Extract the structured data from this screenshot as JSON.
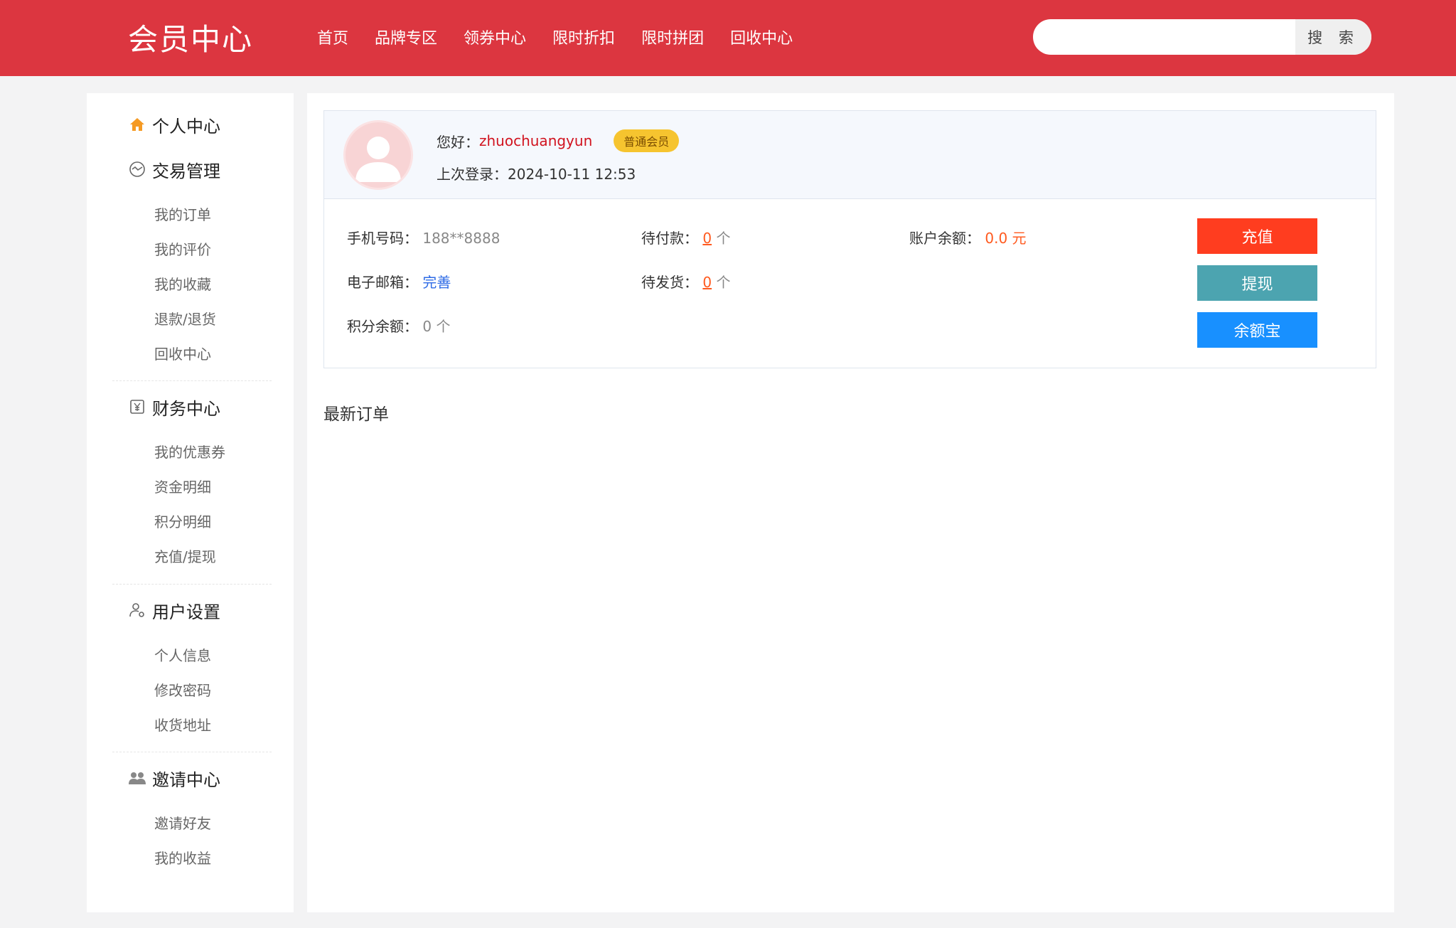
{
  "header": {
    "logo": "会员中心",
    "nav": [
      "首页",
      "品牌专区",
      "领券中心",
      "限时折扣",
      "限时拼团",
      "回收中心"
    ],
    "search": {
      "placeholder": "",
      "button_label": "搜 索"
    }
  },
  "sidebar": {
    "groups": [
      {
        "title": "个人中心",
        "icon": "home-icon",
        "items": []
      },
      {
        "title": "交易管理",
        "icon": "trade-icon",
        "items": [
          "我的订单",
          "我的评价",
          "我的收藏",
          "退款/退货",
          "回收中心"
        ]
      },
      {
        "title": "财务中心",
        "icon": "finance-icon",
        "items": [
          "我的优惠券",
          "资金明细",
          "积分明细",
          "充值/提现"
        ]
      },
      {
        "title": "用户设置",
        "icon": "user-settings-icon",
        "items": [
          "个人信息",
          "修改密码",
          "收货地址"
        ]
      },
      {
        "title": "邀请中心",
        "icon": "invite-icon",
        "items": [
          "邀请好友",
          "我的收益"
        ]
      }
    ]
  },
  "profile": {
    "greeting": "您好：",
    "username": "zhuochuangyun",
    "level": "普通会员",
    "last_login_label": "上次登录：",
    "last_login": "2024-10-11 12:53"
  },
  "stats": {
    "phone_label": "手机号码：",
    "phone": "188**8888",
    "email_label": "电子邮箱：",
    "email": "完善",
    "points_label": "积分余额：",
    "points": "0 个",
    "pending_pay_label": "待付款：",
    "pending_pay": "0",
    "pending_ship_label": "待发货：",
    "pending_ship": "0",
    "unit": "个",
    "balance_label": "账户余额：",
    "balance": "0.0 元"
  },
  "buttons": {
    "charge": "充值",
    "withdraw": "提现",
    "yue": "余额宝"
  },
  "orders": {
    "title": "最新订单"
  },
  "colors": {
    "brand": "#dc3640",
    "accent_orange": "#ff5a1f",
    "charge": "#ff3d1f",
    "withdraw": "#4ca4b0",
    "yue": "#1890ff",
    "badge": "#f6c42f"
  }
}
